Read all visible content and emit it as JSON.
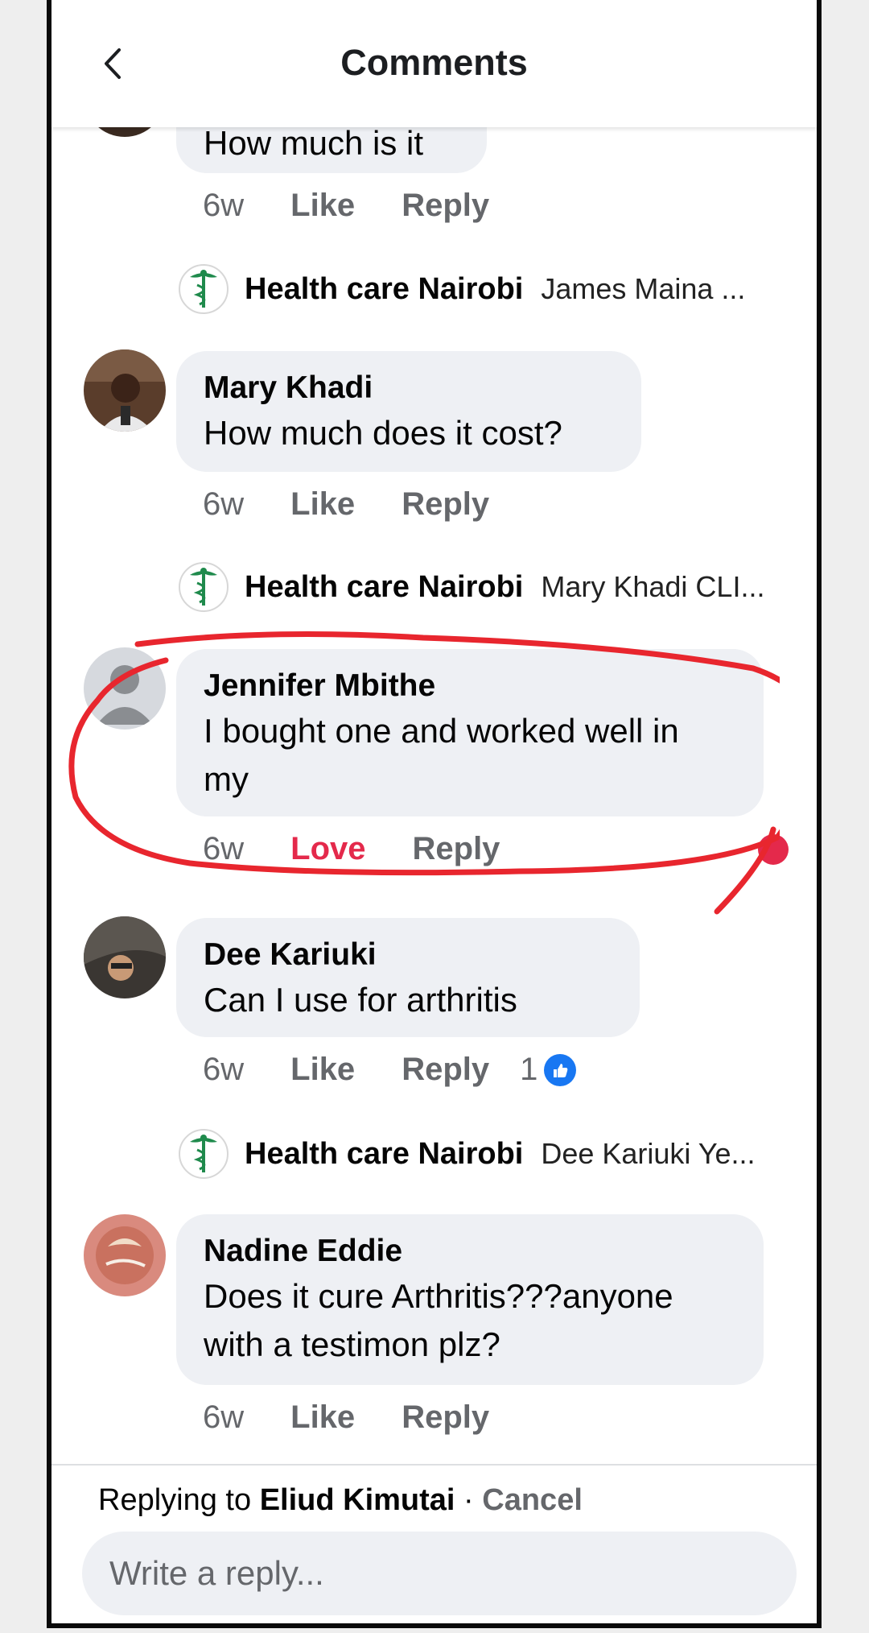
{
  "header": {
    "title": "Comments"
  },
  "top_partial": {
    "text": "How much is it",
    "time": "6w",
    "like": "Like",
    "reply": "Reply"
  },
  "comments": [
    {
      "name": "Mary Khadi",
      "lines": [
        "How much does it cost?"
      ],
      "time": "6w",
      "like": "Like",
      "reply": "Reply"
    },
    {
      "name": "Jennifer Mbithe",
      "lines": [
        "I bought one and worked well in",
        "my"
      ],
      "time": "6w",
      "like": "Love",
      "reply": "Reply"
    },
    {
      "name": "Dee Kariuki",
      "lines": [
        "Can I use for arthritis"
      ],
      "time": "6w",
      "like": "Like",
      "reply": "Reply",
      "reactions": "1"
    },
    {
      "name": "Nadine Eddie",
      "lines": [
        "Does it cure Arthritis???anyone",
        "with a testimon plz?"
      ],
      "time": "6w",
      "like": "Like",
      "reply": "Reply"
    }
  ],
  "page_replies": [
    {
      "name": "Health care Nairobi",
      "text": "James Maina ..."
    },
    {
      "name": "Health care Nairobi",
      "text": "Mary Khadi CLI..."
    },
    {
      "name": "Health care Nairobi",
      "text": "Dee Kariuki Ye..."
    }
  ],
  "footer": {
    "replying_prefix": "Replying to",
    "replying_name": "Eliud Kimutai",
    "separator": " · ",
    "cancel": "Cancel",
    "placeholder": "Write a reply..."
  },
  "colors": {
    "love": "#e4294b",
    "like_badge": "#1877f2",
    "bubble": "#eef0f4",
    "annotation": "#e8262e",
    "page_logo": "#1f8a4c"
  },
  "icons": [
    "chevron-left-icon",
    "caduceus-logo-icon",
    "like-reaction-icon",
    "love-reaction-icon"
  ]
}
